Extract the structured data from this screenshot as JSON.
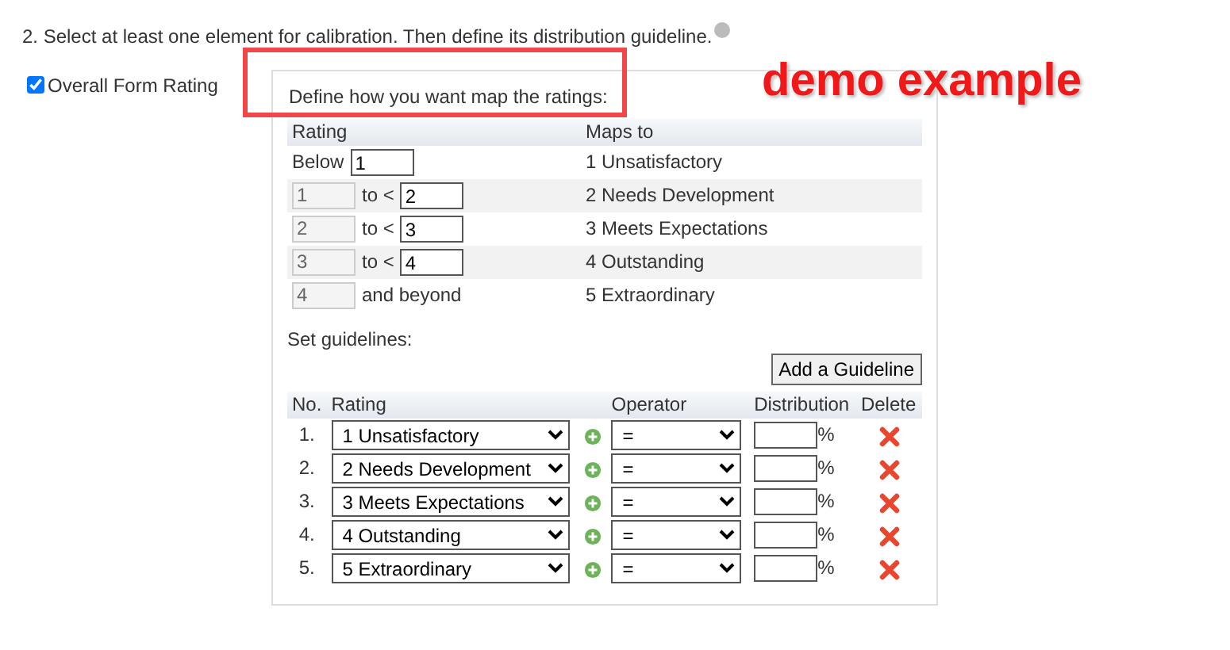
{
  "instruction": "2. Select at least one element for calibration. Then define its distribution guideline.",
  "element": {
    "label": "Overall Form Rating",
    "checked": true
  },
  "annotation": {
    "text": "demo example"
  },
  "mapping": {
    "title": "Define how you want map the ratings:",
    "columns": [
      "Rating",
      "Maps to"
    ],
    "rows": [
      {
        "kind": "below",
        "prefix": "Below",
        "limit": "1",
        "maps_to": "1 Unsatisfactory"
      },
      {
        "kind": "range",
        "from": "1",
        "connector": "to <",
        "to": "2",
        "maps_to": "2 Needs Development"
      },
      {
        "kind": "range",
        "from": "2",
        "connector": "to <",
        "to": "3",
        "maps_to": "3 Meets Expectations"
      },
      {
        "kind": "range",
        "from": "3",
        "connector": "to <",
        "to": "4",
        "maps_to": "4 Outstanding"
      },
      {
        "kind": "beyond",
        "from": "4",
        "connector": "and beyond",
        "maps_to": "5 Extraordinary"
      }
    ]
  },
  "guidelines": {
    "title": "Set guidelines:",
    "add_button": "Add a Guideline",
    "columns": [
      "No.",
      "Rating",
      "Operator",
      "Distribution",
      "Delete"
    ],
    "rows": [
      {
        "no": "1.",
        "rating": "1 Unsatisfactory",
        "operator": "=",
        "unit": "%"
      },
      {
        "no": "2.",
        "rating": "2 Needs Development",
        "operator": "=",
        "unit": "%"
      },
      {
        "no": "3.",
        "rating": "3 Meets Expectations",
        "operator": "=",
        "unit": "%"
      },
      {
        "no": "4.",
        "rating": "4 Outstanding",
        "operator": "=",
        "unit": "%"
      },
      {
        "no": "5.",
        "rating": "5 Extraordinary",
        "operator": "=",
        "unit": "%"
      }
    ]
  }
}
